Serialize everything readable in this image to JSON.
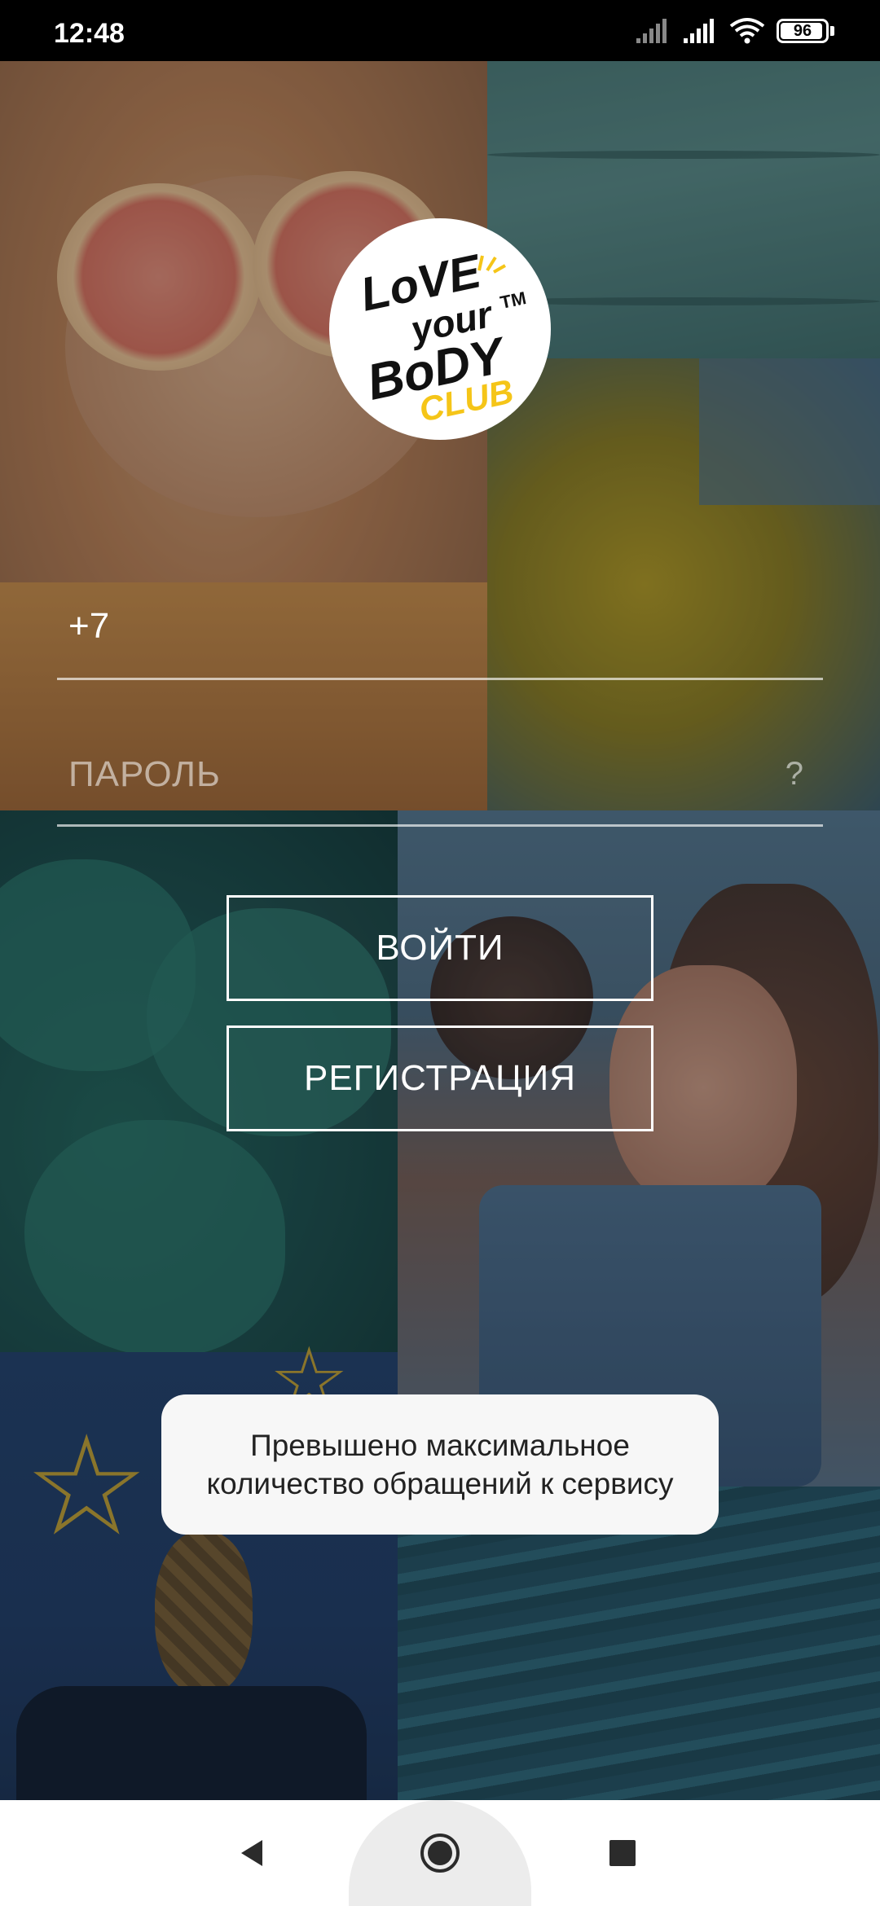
{
  "status_bar": {
    "time": "12:48",
    "battery": "96",
    "icons": [
      "signal-icon",
      "signal-icon",
      "wifi-icon",
      "battery-icon"
    ]
  },
  "logo": {
    "line1": "LoVE",
    "line2": "your",
    "line3": "BoDY",
    "line4": "CLUB",
    "tm": "TM"
  },
  "form": {
    "phone_value": "+7",
    "password_placeholder": "ПАРОЛЬ",
    "password_help": "?"
  },
  "buttons": {
    "login": "ВОЙТИ",
    "register": "РЕГИСТРАЦИЯ"
  },
  "toast": {
    "message": "Превышено максимальное количество обращений к сервису"
  },
  "colors": {
    "accent": "#f5c518",
    "toast_bg": "#f7f7f7",
    "button_border": "#ffffff"
  }
}
